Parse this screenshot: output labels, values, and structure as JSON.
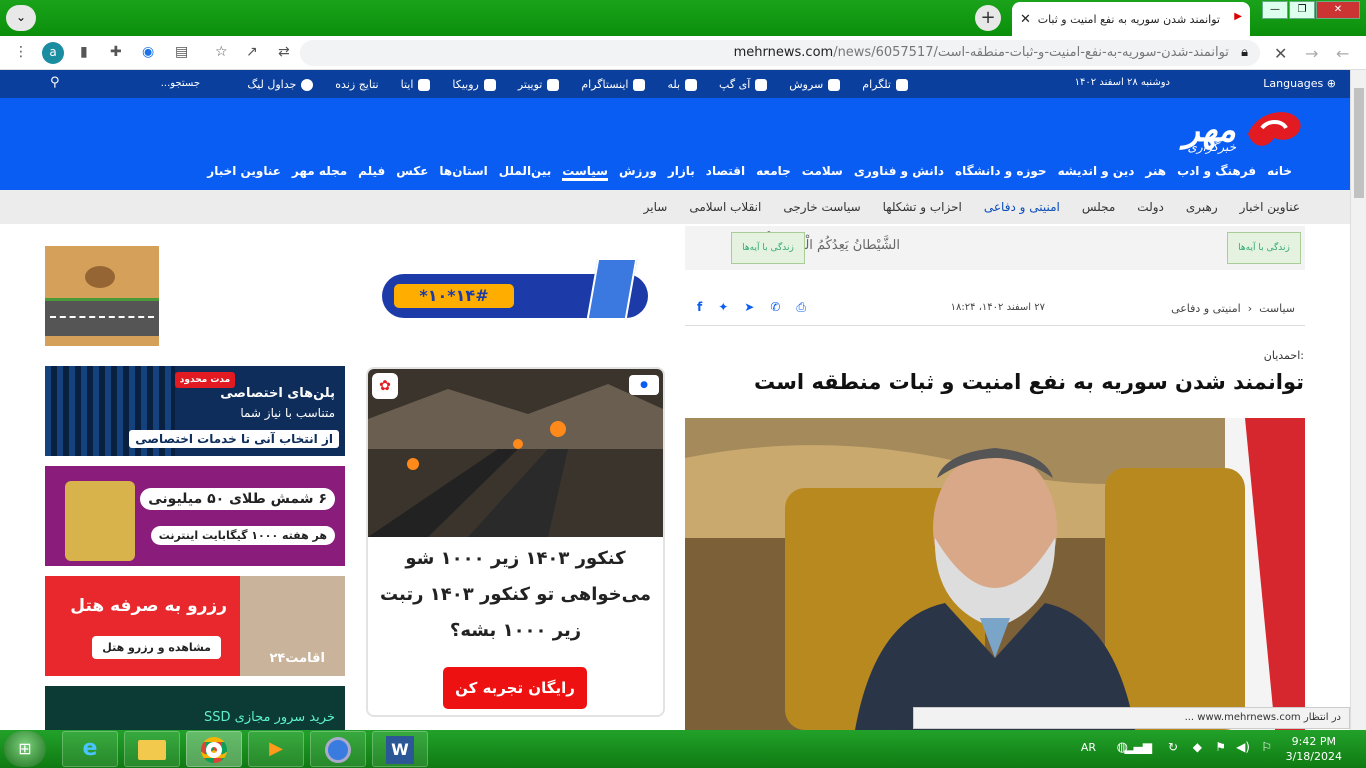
{
  "browser": {
    "tab_title": "توانمند شدن سوریه به نفع امنیت و ثبات منط",
    "address_domain": "mehrnews.com",
    "address_path": "/news/6057517/توانمند-شدن-سوریه-به-نفع-امنیت-و-ثبات-منطقه-است",
    "profile_initial": "a"
  },
  "topbar": {
    "languages": "Languages",
    "date": "دوشنبه ۲۸ اسفند ۱۴۰۲",
    "social": [
      "تلگرام",
      "سروش",
      "آی گپ",
      "بله",
      "اینستاگرام",
      "توییتر",
      "روبیکا",
      "ایتا",
      "نتایج زنده",
      "جداول لیگ"
    ],
    "search_placeholder": "جستجو..."
  },
  "site": {
    "logo_main": "مهر",
    "logo_sub": "خبرگزاری",
    "logo_colors": {
      "brand": "#0a5df2",
      "logo_red": "#e21b22"
    }
  },
  "mainnav": [
    "خانه",
    "فرهنگ و ادب",
    "هنر",
    "دین و اندیشه",
    "حوزه و دانشگاه",
    "دانش و فناوری",
    "سلامت",
    "جامعه",
    "اقتصاد",
    "بازار",
    "ورزش",
    "سیاست",
    "بین‌الملل",
    "استان‌ها",
    "عکس",
    "فیلم",
    "مجله مهر",
    "عناوین اخبار"
  ],
  "mainnav_active": "سیاست",
  "subnav": [
    "عناوین اخبار",
    "رهبری",
    "دولت",
    "مجلس",
    "امنیتی و دفاعی",
    "احزاب و تشکلها",
    "سیاست خارجی",
    "انقلاب اسلامی",
    "سایر"
  ],
  "subnav_active": "امنیتی و دفاعی",
  "quote_banner": {
    "text": "الشَّيْطانُ يَعِدُكُمُ الْفَقْرَ وَيَأْ",
    "badge": "زندگی با آیه‌ها"
  },
  "article": {
    "breadcrumb_1": "سیاست",
    "breadcrumb_2": "امنیتی و دفاعی",
    "date": "۲۷ اسفند ۱۴۰۲، ۱۸:۲۴",
    "lead": "احمدیان:",
    "title": "توانمند شدن سوریه به نفع امنیت و ثبات منطقه است"
  },
  "share_icons": [
    "facebook-icon",
    "twitter-icon",
    "telegram-icon",
    "whatsapp-icon",
    "print-icon"
  ],
  "ussd_ad": {
    "code": "*۱۰*۱۴#"
  },
  "ads": {
    "hosting_1": "پلن‌های اختصاصی",
    "hosting_2": "متناسب با نیاز شما",
    "hosting_3": "از انتخاب آنی تا خدمات اختصاصی",
    "hosting_badge": "مدت محدود",
    "gold_1": "۶ شمش طلای ۵۰ میلیونی",
    "gold_2": "هر هفته ۱۰۰۰ گیگابایت اینترنت",
    "hotel_1": "رزرو به صرفه هتل",
    "hotel_2": "مشاهده و رزرو هتل",
    "hotel_brand": "اقامت۲۴",
    "ssd": "خرید سرور مجازی SSD"
  },
  "promo": {
    "line1": "کنکور ۱۴۰۳ زیر ۱۰۰۰ شو",
    "line2": "می‌خواهی تو کنکور ۱۴۰۳ رتبت",
    "line3": "زیر ۱۰۰۰ بشه؟",
    "cta": "رایگان تجربه کن"
  },
  "status": {
    "loading": "در انتظار www.mehrnews.com ..."
  },
  "taskbar": {
    "lang": "AR",
    "time": "9:42 PM",
    "date": "3/18/2024"
  }
}
